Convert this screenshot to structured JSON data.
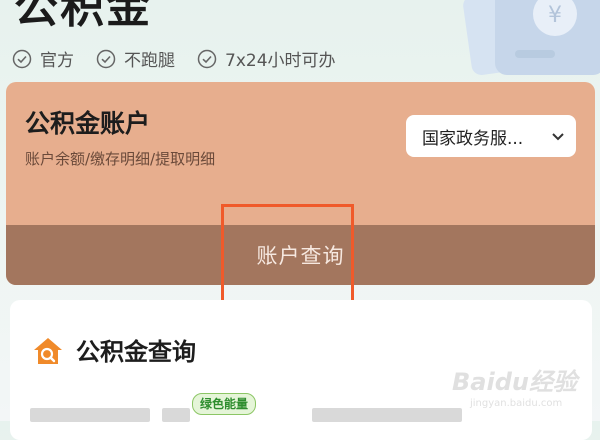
{
  "page": {
    "title": "公积金"
  },
  "badges": [
    {
      "label": "官方",
      "icon": "check-circle-icon"
    },
    {
      "label": "不跑腿",
      "icon": "check-circle-icon"
    },
    {
      "label": "7x24小时可办",
      "icon": "check-circle-icon"
    }
  ],
  "account_card": {
    "title": "公积金账户",
    "subtitle": "账户余额/缴存明细/提取明细",
    "region_select": {
      "value": "国家政务服...",
      "icon": "chevron-down-icon"
    },
    "query_button": "账户查询"
  },
  "query_section": {
    "title": "公积金查询",
    "icon": "house-search-icon",
    "tag": "绿色能量"
  },
  "watermark": {
    "brand": "Baidu经验",
    "domain": "jingyan.baidu.com"
  },
  "colors": {
    "card_bg": "#e7ae8e",
    "query_bar_bg": "#a3765e",
    "highlight": "#f05a2a",
    "icon_orange": "#f08a2a",
    "tag_green": "#2e8d2e"
  }
}
